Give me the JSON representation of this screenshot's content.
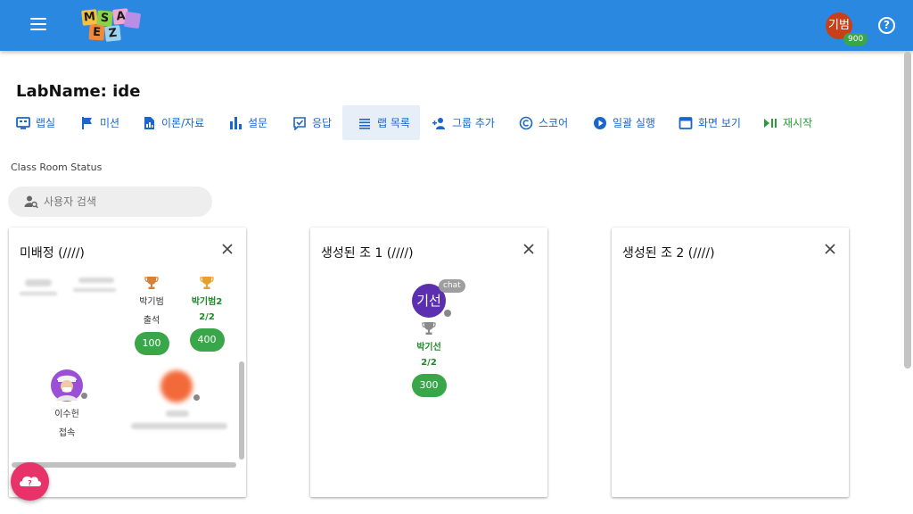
{
  "app": {
    "logo_letters": [
      "M",
      "S",
      "A",
      "E",
      "Z"
    ]
  },
  "user": {
    "initials": "기범",
    "points": "900"
  },
  "page": {
    "title": "LabName: ide",
    "status_label": "Class Room Status"
  },
  "toolbar": {
    "items": [
      {
        "label": "랩실",
        "icon": "monitor-icon"
      },
      {
        "label": "미션",
        "icon": "flag-icon"
      },
      {
        "label": "이론/자료",
        "icon": "document-icon"
      },
      {
        "label": "설문",
        "icon": "bar-chart-icon"
      },
      {
        "label": "응답",
        "icon": "check-box-icon"
      },
      {
        "label": "랩 목록",
        "icon": "list-icon"
      },
      {
        "label": "그룹 추가",
        "icon": "group-add-icon"
      },
      {
        "label": "스코어",
        "icon": "copyright-icon"
      },
      {
        "label": "일괄 실행",
        "icon": "play-circle-icon"
      },
      {
        "label": "화면 보기",
        "icon": "window-icon"
      },
      {
        "label": "재시작",
        "icon": "play-pause-icon"
      }
    ]
  },
  "search": {
    "placeholder": "사용자 검색"
  },
  "cards": [
    {
      "title": "미배정 (////)",
      "members": [
        {
          "name": "박기범",
          "status": "출석",
          "score": "100",
          "highlight": false
        },
        {
          "name": "박기범2",
          "status": "2/2",
          "score": "400",
          "highlight": true
        },
        {
          "name": "이수헌",
          "status": "접속",
          "score": "",
          "highlight": false
        }
      ]
    },
    {
      "title": "생성된 조 1 (////)",
      "members": [
        {
          "initials": "기선",
          "chat": "chat",
          "name": "박기선",
          "status": "2/2",
          "score": "300"
        }
      ]
    },
    {
      "title": "생성된 조 2 (////)",
      "members": []
    }
  ],
  "colors": {
    "appbar": "#2a88e0",
    "accent": "#1b66c9",
    "success": "#3aa64a",
    "fab": "#e8336a",
    "avatar_purple": "#5b2fb0"
  }
}
